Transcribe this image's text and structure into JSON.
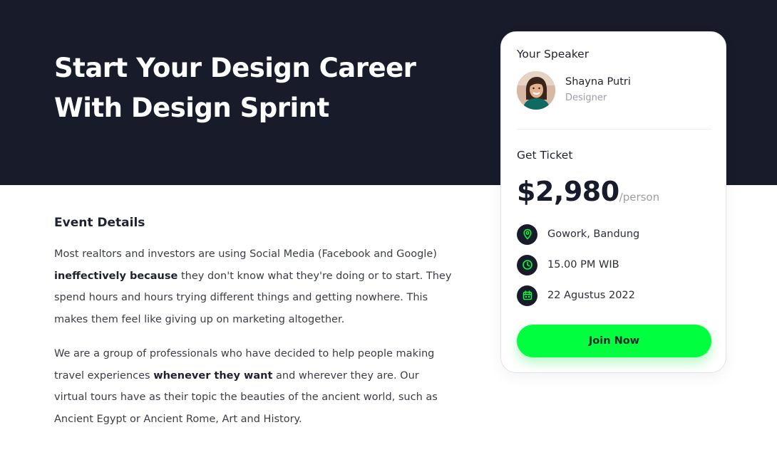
{
  "hero": {
    "title_line1": "Start Your Design Career",
    "title_line2": "With Design Sprint",
    "background_color": "#181c2a"
  },
  "event_details": {
    "heading": "Event Details",
    "paragraph1": {
      "part1": "Most realtors and investors are using Social Media (Facebook and Google) ",
      "bold": "ineffectively because",
      "part2": " they don't know what they're doing or to start. They spend hours and hours trying different things and getting nowhere. This makes them feel like giving up on marketing altogether."
    },
    "paragraph2": {
      "part1": "We are a group of professionals who have decided to help people making travel experiences ",
      "bold": "whenever they want",
      "part2": " and wherever they are. Our virtual tours have as their topic the beauties of the ancient world, such as Ancient Egypt or Ancient Rome, Art and History."
    }
  },
  "card": {
    "speaker_label": "Your Speaker",
    "speaker": {
      "name": "Shayna Putri",
      "role": "Designer",
      "avatar_icon": "speaker-avatar"
    },
    "ticket_label": "Get Ticket",
    "price": "$2,980",
    "price_unit": "/person",
    "details": [
      {
        "icon": "location-pin-icon",
        "text": "Gowork, Bandung"
      },
      {
        "icon": "clock-icon",
        "text": "15.00 PM WIB"
      },
      {
        "icon": "calendar-icon",
        "text": "22 Agustus 2022"
      }
    ],
    "join_label": "Join Now"
  },
  "colors": {
    "accent": "#00ff3e",
    "dark": "#181c2a",
    "muted": "#9b9ea8"
  }
}
